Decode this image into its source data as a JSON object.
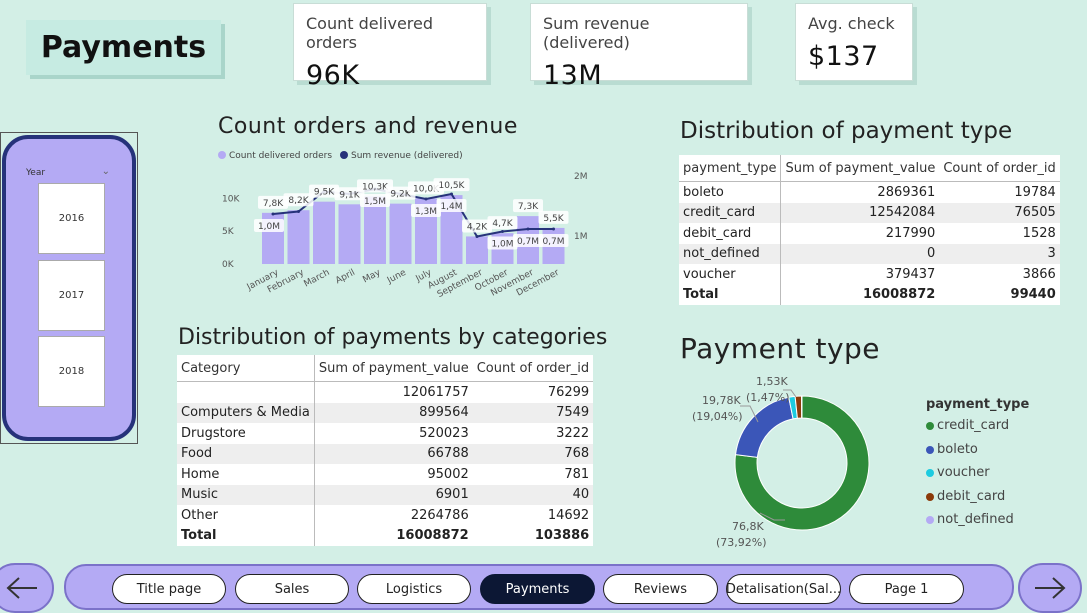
{
  "page_title": "Payments",
  "kpis": [
    {
      "label": "Count delivered orders",
      "value": "96K"
    },
    {
      "label": "Sum revenue (delivered)",
      "value": "13M"
    },
    {
      "label": "Avg. check",
      "value": "$137"
    }
  ],
  "slicer": {
    "header": "Year",
    "items": [
      "2016",
      "2017",
      "2018"
    ]
  },
  "monthly_chart": {
    "title": "Count orders and revenue",
    "legend": [
      "Count delivered orders",
      "Sum revenue (delivered)"
    ],
    "left_ticks": [
      "10K",
      "5K",
      "0K"
    ],
    "right_ticks": [
      "2M",
      "1M"
    ]
  },
  "chart_data": {
    "type": "bar",
    "categories": [
      "January",
      "February",
      "March",
      "April",
      "May",
      "June",
      "July",
      "August",
      "September",
      "October",
      "November",
      "December"
    ],
    "series": [
      {
        "name": "Count delivered orders",
        "type": "bar",
        "values": [
          7.8,
          8.2,
          9.5,
          9.1,
          10.3,
          9.2,
          10.0,
          10.5,
          4.2,
          4.7,
          7.3,
          5.5
        ],
        "labels": [
          "7,8K",
          "8,2K",
          "9,5K",
          "9,1K",
          "10,3K",
          "9,2K",
          "10,0K",
          "10,5K",
          "4,2K",
          "4,7K",
          "7,3K",
          "5,5K"
        ]
      },
      {
        "name": "Sum revenue (delivered)",
        "type": "line",
        "values": [
          1.0,
          1.05,
          1.45,
          1.4,
          1.5,
          1.4,
          1.3,
          1.4,
          0.55,
          0.65,
          0.7,
          0.7
        ],
        "labels": [
          "1,0M",
          "",
          "",
          "",
          "1,5M",
          "",
          "1,3M",
          "1,4M",
          "",
          "1,0M",
          "0,7M",
          "0,7M"
        ]
      }
    ],
    "y_left_unit": "K",
    "ylim_left": [
      0,
      12.5
    ],
    "y_right_unit": "M",
    "ylim_right": [
      0,
      2.0
    ]
  },
  "payment_type_table": {
    "title": "Distribution of payment type",
    "headers": [
      "payment_type",
      "Sum of payment_value",
      "Count of order_id"
    ],
    "rows": [
      [
        "boleto",
        "2869361",
        "19784"
      ],
      [
        "credit_card",
        "12542084",
        "76505"
      ],
      [
        "debit_card",
        "217990",
        "1528"
      ],
      [
        "not_defined",
        "0",
        "3"
      ],
      [
        "voucher",
        "379437",
        "3866"
      ]
    ],
    "total": [
      "Total",
      "16008872",
      "99440"
    ]
  },
  "categories_table": {
    "title": "Distribution of payments by categories",
    "headers": [
      "Category",
      "Sum of payment_value",
      "Count of order_id"
    ],
    "rows": [
      [
        "",
        "12061757",
        "76299"
      ],
      [
        "Computers & Media",
        "899564",
        "7549"
      ],
      [
        "Drugstore",
        "520023",
        "3222"
      ],
      [
        "Food",
        "66788",
        "768"
      ],
      [
        "Home",
        "95002",
        "781"
      ],
      [
        "Music",
        "6901",
        "40"
      ],
      [
        "Other",
        "2264786",
        "14692"
      ]
    ],
    "total": [
      "Total",
      "16008872",
      "103886"
    ]
  },
  "donut": {
    "title": "Payment type",
    "legend_title": "payment_type",
    "slices": [
      {
        "name": "credit_card",
        "pct": 73.92,
        "color": "#2e8b3a"
      },
      {
        "name": "boleto",
        "pct": 19.04,
        "color": "#3b56b8"
      },
      {
        "name": "voucher",
        "pct": 1.47,
        "color": "#1ccbe0"
      },
      {
        "name": "debit_card",
        "pct": 1.47,
        "color": "#8b3a0a"
      },
      {
        "name": "not_defined",
        "pct": 0.1,
        "color": "#b4aaf4"
      }
    ],
    "callouts": [
      {
        "value": "76,8K",
        "pct": "(73,92%)"
      },
      {
        "value": "19,78K",
        "pct": "(19,04%)"
      },
      {
        "value": "1,53K",
        "pct": "(1,47%)"
      }
    ]
  },
  "nav": {
    "buttons": [
      "Title page",
      "Sales",
      "Logistics",
      "Payments",
      "Reviews",
      "Detalisation(Sal...",
      "Page 1"
    ],
    "active": "Payments"
  },
  "colors": {
    "background": "#d3efe6",
    "bars": "#b4aaf4",
    "line": "#26327a",
    "accent": "#0c1734"
  }
}
